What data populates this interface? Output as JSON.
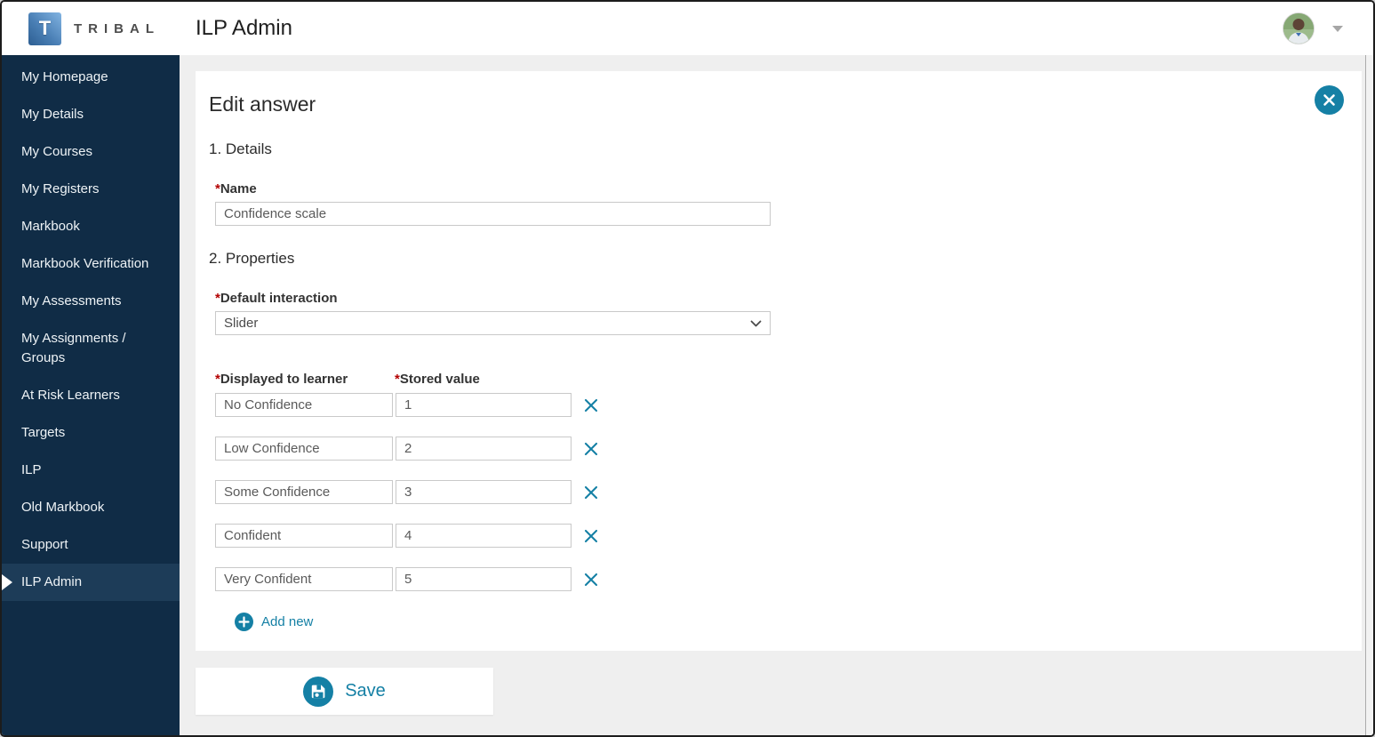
{
  "topbar": {
    "brand_initial": "T",
    "brand": "TRIBAL",
    "title": "ILP Admin"
  },
  "sidebar": {
    "items": [
      {
        "label": "My Homepage"
      },
      {
        "label": "My Details"
      },
      {
        "label": "My Courses"
      },
      {
        "label": "My Registers"
      },
      {
        "label": "Markbook"
      },
      {
        "label": "Markbook Verification"
      },
      {
        "label": "My Assessments"
      },
      {
        "label": "My Assignments / Groups"
      },
      {
        "label": "At Risk Learners"
      },
      {
        "label": "Targets"
      },
      {
        "label": "ILP"
      },
      {
        "label": "Old Markbook"
      },
      {
        "label": "Support"
      },
      {
        "label": "ILP Admin",
        "selected": true
      }
    ]
  },
  "modal": {
    "title": "Edit answer",
    "details_heading": "1. Details",
    "properties_heading": "2. Properties",
    "required_mark": "*",
    "name_field": {
      "label": "Name",
      "value": "Confidence scale"
    },
    "interaction_field": {
      "label": "Default interaction",
      "value": "Slider"
    },
    "answers": {
      "display_label": "Displayed to learner",
      "value_label": "Stored value",
      "rows": [
        {
          "display": "No Confidence",
          "value": "1"
        },
        {
          "display": "Low Confidence",
          "value": "2"
        },
        {
          "display": "Some Confidence",
          "value": "3"
        },
        {
          "display": "Confident",
          "value": "4"
        },
        {
          "display": "Very Confident",
          "value": "5"
        }
      ]
    },
    "add_new_label": "Add new"
  },
  "save_button": {
    "label": "Save"
  },
  "icons": {
    "close": "close-icon (white x in teal circle)",
    "delete": "x-delete-icon (teal x)",
    "add": "plus-circle-icon (teal circle, white plus)",
    "save": "floppy-disk-icon (white floppy in teal circle)",
    "select": "chevron-down-icon",
    "user_menu": "chevron-down-icon",
    "selected_nav": "right-arrow-indicator"
  },
  "colors": {
    "accent_teal": "#1580a5",
    "sidebar_navy": "#102c46",
    "sidebar_selected": "#1d3c58",
    "page_background": "#efefef",
    "required_red": "#b30000",
    "logo_gradient_start": "#82b4e2",
    "logo_gradient_end": "#2d5e92"
  }
}
